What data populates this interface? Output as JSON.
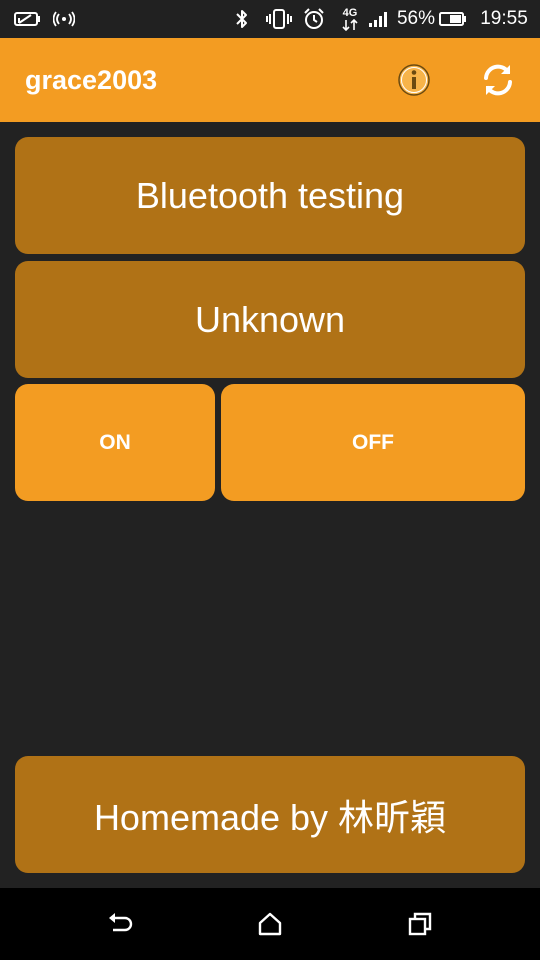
{
  "status_bar": {
    "battery_percent": "56%",
    "time": "19:55",
    "network_label": "4G",
    "icons": [
      "battery-saver-icon",
      "wifi-hotspot-icon",
      "bluetooth-icon",
      "vibrate-icon",
      "alarm-icon",
      "data-transfer-icon",
      "signal-icon",
      "battery-icon"
    ]
  },
  "app_bar": {
    "title": "grace2003",
    "actions": [
      "info-icon",
      "refresh-icon"
    ]
  },
  "main": {
    "title_button": "Bluetooth testing",
    "status_button": "Unknown",
    "on_button": "ON",
    "off_button": "OFF",
    "footer_button": "Homemade by 林昕穎"
  },
  "nav_bar": {
    "buttons": [
      "back-icon",
      "home-icon",
      "recents-icon"
    ]
  },
  "colors": {
    "accent": "#f39c22",
    "tile_dark": "#b07216",
    "background": "#222222",
    "status_bar": "#212121",
    "nav_bar": "#000000"
  }
}
